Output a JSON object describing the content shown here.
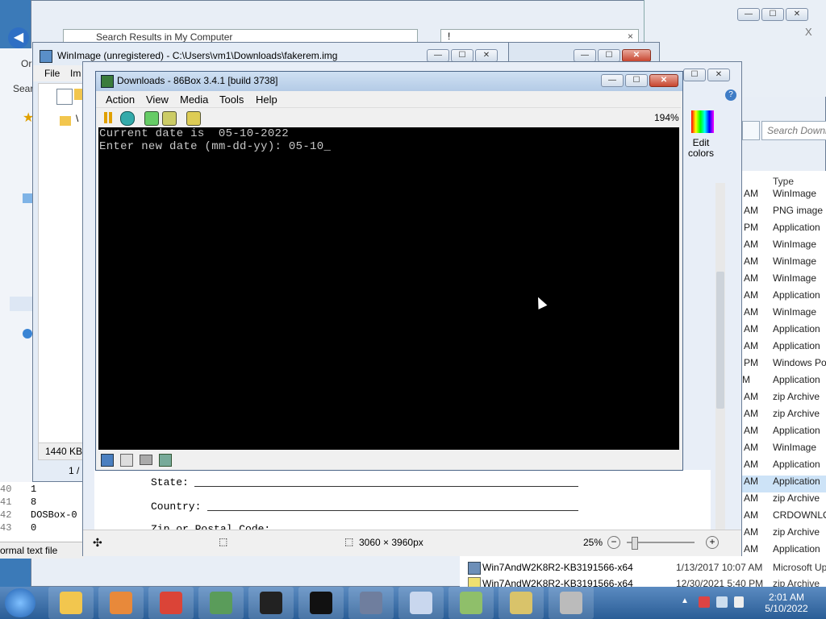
{
  "explorer": {
    "address": "Search Results in My Computer",
    "search_placeholder": "Search Downl",
    "column_type": "Type",
    "close_glyph": "X",
    "rows": [
      {
        "time": "AM",
        "type": "WinImage"
      },
      {
        "time": "AM",
        "type": "PNG image"
      },
      {
        "time": "PM",
        "type": "Application"
      },
      {
        "time": "AM",
        "type": "WinImage"
      },
      {
        "time": "AM",
        "type": "WinImage"
      },
      {
        "time": "AM",
        "type": "WinImage"
      },
      {
        "time": "AM",
        "type": "Application"
      },
      {
        "time": "AM",
        "type": "WinImage"
      },
      {
        "time": "AM",
        "type": "Application"
      },
      {
        "time": "AM",
        "type": "Application"
      },
      {
        "time": "PM",
        "type": "Windows Po"
      },
      {
        "time": "M",
        "type": "Application"
      },
      {
        "time": "AM",
        "type": "zip Archive"
      },
      {
        "time": "AM",
        "type": "zip Archive"
      },
      {
        "time": "AM",
        "type": "Application"
      },
      {
        "time": "AM",
        "type": "WinImage"
      },
      {
        "time": "AM",
        "type": "Application"
      },
      {
        "time": "AM",
        "type": "Application"
      },
      {
        "time": "AM",
        "type": "zip Archive"
      },
      {
        "time": "AM",
        "type": "CRDOWNLO"
      },
      {
        "time": "AM",
        "type": "zip Archive"
      },
      {
        "time": "AM",
        "type": "Application"
      }
    ],
    "bottom_files": [
      {
        "name": "Win7AndW2K8R2-KB3191566-x64",
        "date": "1/13/2017 10:07 AM",
        "type": "Microsoft Up"
      },
      {
        "name": "Win7AndW2K8R2-KB3191566-x64",
        "date": "12/30/2021 5:40 PM",
        "type": "zip Archive"
      }
    ]
  },
  "left_panel": {
    "org_label": "Or",
    "search_label": "Searc",
    "file_menu": "File",
    "image_menu": "Im",
    "size_status": "1440 KB",
    "page_status": "1 /",
    "list_numbers": [
      "40",
      "41",
      "42",
      "43"
    ],
    "list_values": [
      "1",
      "8",
      "DOSBox-0",
      "0"
    ],
    "status_text": "ormal text file"
  },
  "winimage": {
    "title": "WinImage (unregistered) - C:\\Users\\vm1\\Downloads\\fakerem.img"
  },
  "paint": {
    "edit_colors": "Edit\ncolors",
    "doc_lines": [
      "State:",
      "Country:",
      "Zip or Postal Code:"
    ],
    "dimensions": "3060 × 3960px",
    "zoom": "25%"
  },
  "box86": {
    "title": "Downloads - 86Box 3.4.1 [build 3738]",
    "menus": [
      "Action",
      "View",
      "Media",
      "Tools",
      "Help"
    ],
    "zoom": "194%",
    "terminal_lines": [
      "Current date is  05-10-2022",
      "Enter new date (mm-dd-yy): 05-10_"
    ]
  },
  "taskbar": {
    "time": "2:01 AM",
    "date": "5/10/2022",
    "apps": [
      "explorer",
      "media-player",
      "chrome",
      "winimage",
      "7zip",
      "cmd",
      "86box",
      "paint",
      "notepadpp",
      "cd-burner",
      "disc-tool"
    ]
  }
}
